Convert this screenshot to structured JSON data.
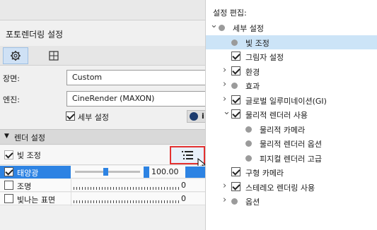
{
  "left_panel": {
    "title": "포토렌더링 설정",
    "fields": {
      "scene_label": "장면:",
      "scene_value": "Custom",
      "engine_label": "엔진:",
      "engine_value": "CineRender (MAXON)",
      "detail_checkbox_label": "세부 설정",
      "detail_checked": true
    },
    "section_header": "렌더 설정",
    "light_adjust": {
      "label": "빛 조정",
      "checked": true
    },
    "light_rows": [
      {
        "label": "태양광",
        "checked": true,
        "value": "100.00",
        "slider_fraction": 0.45,
        "selected": true
      },
      {
        "label": "조명",
        "checked": false,
        "value": "0",
        "slider_fraction": 0
      },
      {
        "label": "빛나는 표면",
        "checked": false,
        "value": "0",
        "slider_fraction": 0
      }
    ],
    "info_icon_text": "i"
  },
  "right_panel": {
    "title": "설정 편집:",
    "tree": [
      {
        "label": "세부 설정",
        "level": 0,
        "expanded": true,
        "marker": "dot",
        "checked": false
      },
      {
        "label": "빛 조정",
        "level": 1,
        "marker": "dot",
        "selected": true,
        "checked": false
      },
      {
        "label": "그림자 설정",
        "level": 1,
        "marker": "checkbox",
        "checked": true
      },
      {
        "label": "환경",
        "level": 1,
        "marker": "checkbox",
        "checked": true,
        "expandable": true
      },
      {
        "label": "효과",
        "level": 1,
        "marker": "dot",
        "expandable": true,
        "checked": false
      },
      {
        "label": "글로벌 일루미네이션(GI)",
        "level": 1,
        "marker": "checkbox",
        "checked": true,
        "expandable": true
      },
      {
        "label": "물리적 렌더러 사용",
        "level": 1,
        "marker": "checkbox",
        "checked": true,
        "expandable": true,
        "expanded": true
      },
      {
        "label": "물리적 카메라",
        "level": 2,
        "marker": "dot",
        "checked": false
      },
      {
        "label": "물리적 렌더러 옵션",
        "level": 2,
        "marker": "dot",
        "checked": false
      },
      {
        "label": "피지컬 렌더러 고급",
        "level": 2,
        "marker": "dot",
        "checked": false
      },
      {
        "label": "구형 카메라",
        "level": 1,
        "marker": "checkbox",
        "checked": true
      },
      {
        "label": "스테레오 렌더링 사용",
        "level": 1,
        "marker": "checkbox",
        "checked": true,
        "expandable": true
      },
      {
        "label": "옵션",
        "level": 1,
        "marker": "dot",
        "expandable": true,
        "checked": false
      }
    ]
  },
  "colors": {
    "accent_blue": "#2d83e3",
    "selection": "#cce4f7",
    "highlight_border": "#e33131"
  }
}
